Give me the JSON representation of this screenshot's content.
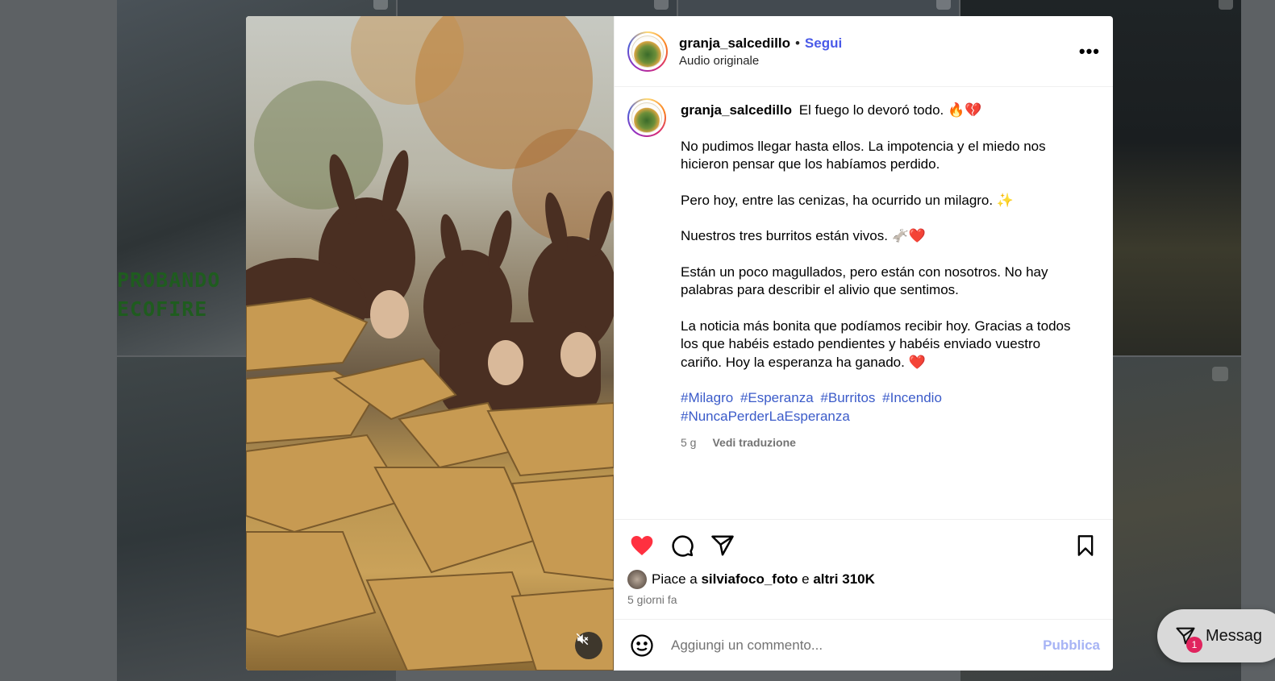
{
  "background": {
    "tile_text": "PROBANDO  EL\nECOFIRE"
  },
  "messages": {
    "label": "Messag",
    "badge": "1",
    "icon": "messenger-icon"
  },
  "post": {
    "username": "granja_salcedillo",
    "separator": "•",
    "follow_label": "Segui",
    "audio_label": "Audio originale",
    "more_label": "•••",
    "caption": {
      "username": "granja_salcedillo",
      "first_line": "El fuego lo devoró todo. 🔥💔",
      "paragraphs": [
        "No pudimos llegar hasta ellos. La impotencia y el miedo nos hicieron pensar que los habíamos perdido.",
        "Pero hoy, entre las cenizas, ha ocurrido un milagro. ✨",
        "Nuestros tres burritos están vivos. 🫏❤️",
        "Están un poco magullados, pero están con nosotros. No hay palabras para describir el alivio que sentimos.",
        "La noticia más bonita que podíamos recibir hoy. Gracias a todos los que habéis estado pendientes y habéis enviado vuestro cariño. Hoy la esperanza ha ganado. ❤️"
      ],
      "hashtags": [
        "#Milagro",
        "#Esperanza",
        "#Burritos",
        "#Incendio",
        "#NuncaPerderLaEsperanza"
      ],
      "age": "5 g",
      "translate_label": "Vedi traduzione"
    },
    "actions": {
      "like_icon": "heart-filled-icon",
      "comment_icon": "comment-icon",
      "share_icon": "share-icon",
      "save_icon": "bookmark-icon",
      "like_color": "#ff3040"
    },
    "likes": {
      "prefix": "Piace a",
      "liker": "silviafoco_foto",
      "conjunction": "e",
      "others": "altri 310K"
    },
    "time_ago": "5 giorni fa",
    "comment": {
      "placeholder": "Aggiungi un commento...",
      "publish_label": "Pubblica",
      "emoji_icon": "emoji-icon"
    },
    "media": {
      "mute_icon": "muted-speaker-icon"
    }
  }
}
